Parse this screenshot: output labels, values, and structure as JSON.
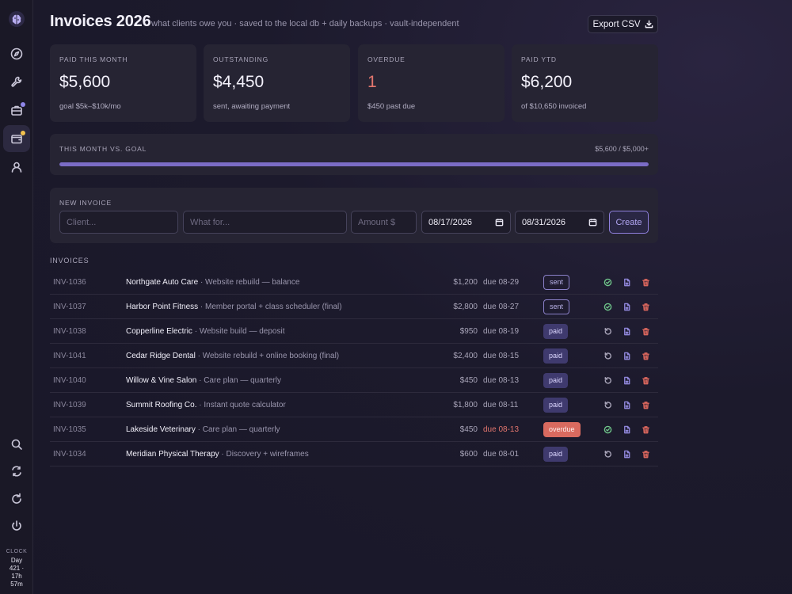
{
  "sidebar": {
    "nav": [
      {
        "icon": "compass-icon"
      },
      {
        "icon": "wrench-icon"
      },
      {
        "icon": "briefcase-icon",
        "dot": "#8f86e8"
      },
      {
        "icon": "wallet-icon",
        "dot": "#f2c14e",
        "active": true
      },
      {
        "icon": "user-icon"
      }
    ],
    "bottom": [
      {
        "icon": "search-icon"
      },
      {
        "icon": "sync-icon"
      },
      {
        "icon": "refresh-icon"
      },
      {
        "icon": "power-icon"
      }
    ],
    "clock": {
      "label": "CLOCK",
      "line1": "Day",
      "line2": "421 ·",
      "line3": "17h",
      "line4": "57m"
    }
  },
  "header": {
    "title": "Invoices 2026",
    "subtitle": "what clients owe you · saved to the local db + daily backups · vault-independent",
    "export_label": "Export CSV"
  },
  "cards": [
    {
      "label": "PAID THIS MONTH",
      "value": "$5,600",
      "sub": "goal $5k–$10k/mo"
    },
    {
      "label": "OUTSTANDING",
      "value": "$4,450",
      "sub": "sent, awaiting payment"
    },
    {
      "label": "OVERDUE",
      "value": "1",
      "sub": "$450 past due"
    },
    {
      "label": "PAID YTD",
      "value": "$6,200",
      "sub": "of $10,650 invoiced"
    }
  ],
  "goal": {
    "label": "THIS MONTH VS. GOAL",
    "value_text": "$5,600 / $5,000+",
    "progress": 1.0
  },
  "new_invoice": {
    "label": "NEW INVOICE",
    "client_placeholder": "Client...",
    "what_placeholder": "What for...",
    "amount_placeholder": "Amount $",
    "date1": "08/17/2026",
    "date2": "08/31/2026",
    "create_label": "Create"
  },
  "invoices_label": "INVOICES",
  "invoices": [
    {
      "id": "INV-1036",
      "client": "Northgate Auto Care",
      "desc": " · Website rebuild — balance",
      "amount": "$1,200",
      "due": "due 08-29",
      "status": "sent",
      "overdue": false
    },
    {
      "id": "INV-1037",
      "client": "Harbor Point Fitness",
      "desc": " · Member portal + class scheduler (final)",
      "amount": "$2,800",
      "due": "due 08-27",
      "status": "sent",
      "overdue": false
    },
    {
      "id": "INV-1038",
      "client": "Copperline Electric",
      "desc": " · Website build — deposit",
      "amount": "$950",
      "due": "due 08-19",
      "status": "paid",
      "overdue": false
    },
    {
      "id": "INV-1041",
      "client": "Cedar Ridge Dental",
      "desc": " · Website rebuild + online booking (final)",
      "amount": "$2,400",
      "due": "due 08-15",
      "status": "paid",
      "overdue": false
    },
    {
      "id": "INV-1040",
      "client": "Willow & Vine Salon",
      "desc": " · Care plan — quarterly",
      "amount": "$450",
      "due": "due 08-13",
      "status": "paid",
      "overdue": false
    },
    {
      "id": "INV-1039",
      "client": "Summit Roofing Co.",
      "desc": " · Instant quote calculator",
      "amount": "$1,800",
      "due": "due 08-11",
      "status": "paid",
      "overdue": false
    },
    {
      "id": "INV-1035",
      "client": "Lakeside Veterinary",
      "desc": " · Care plan — quarterly",
      "amount": "$450",
      "due": "due 08-13",
      "status": "overdue",
      "overdue": true
    },
    {
      "id": "INV-1034",
      "client": "Meridian Physical Therapy",
      "desc": " · Discovery + wireframes",
      "amount": "$600",
      "due": "due 08-01",
      "status": "paid",
      "overdue": false
    }
  ]
}
